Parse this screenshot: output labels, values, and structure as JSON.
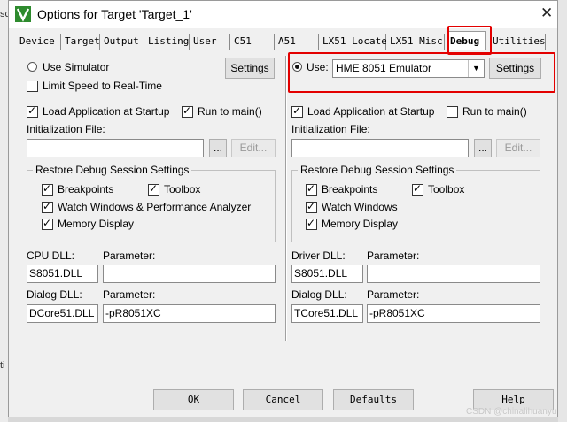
{
  "background": {
    "left_text": "sc",
    "left_text2": "ti"
  },
  "window": {
    "title": "Options for Target 'Target_1'",
    "close_icon": "✕"
  },
  "tabs": [
    {
      "label": "Device"
    },
    {
      "label": "Target"
    },
    {
      "label": "Output"
    },
    {
      "label": "Listing"
    },
    {
      "label": "User"
    },
    {
      "label": "C51"
    },
    {
      "label": "A51"
    },
    {
      "label": "LX51 Locate"
    },
    {
      "label": "LX51 Misc"
    },
    {
      "label": "Debug"
    },
    {
      "label": "Utilities"
    }
  ],
  "left": {
    "use_simulator": "Use Simulator",
    "settings": "Settings",
    "limit_speed": "Limit Speed to Real-Time",
    "load_app": "Load Application at Startup",
    "run_to_main": "Run to main()",
    "init_file_label": "Initialization File:",
    "init_file_value": "",
    "browse": "...",
    "edit": "Edit...",
    "restore_group": "Restore Debug Session Settings",
    "breakpoints": "Breakpoints",
    "toolbox": "Toolbox",
    "watch": "Watch Windows & Performance Analyzer",
    "memory": "Memory Display",
    "cpu_dll_label": "CPU DLL:",
    "cpu_dll_value": "S8051.DLL",
    "parameter_label": "Parameter:",
    "cpu_param_value": "",
    "dialog_dll_label": "Dialog DLL:",
    "dialog_dll_value": "DCore51.DLL",
    "dialog_param_label": "Parameter:",
    "dialog_param_value": "-pR8051XC"
  },
  "right": {
    "use": "Use:",
    "emulator": "HME 8051 Emulator",
    "settings": "Settings",
    "load_app": "Load Application at Startup",
    "run_to_main": "Run to main()",
    "init_file_label": "Initialization File:",
    "init_file_value": "",
    "browse": "...",
    "edit": "Edit...",
    "restore_group": "Restore Debug Session Settings",
    "breakpoints": "Breakpoints",
    "toolbox": "Toolbox",
    "watch": "Watch Windows",
    "memory": "Memory Display",
    "driver_dll_label": "Driver DLL:",
    "driver_dll_value": "S8051.DLL",
    "parameter_label": "Parameter:",
    "driver_param_value": "",
    "dialog_dll_label": "Dialog DLL:",
    "dialog_dll_value": "TCore51.DLL",
    "dialog_param_label": "Parameter:",
    "dialog_param_value": "-pR8051XC"
  },
  "footer": {
    "ok": "OK",
    "cancel": "Cancel",
    "defaults": "Defaults",
    "help": "Help"
  },
  "watermark": "CSDN @chinalihuanyu",
  "colors": {
    "highlight": "#e30000",
    "app_icon": "#2e8b2e"
  }
}
